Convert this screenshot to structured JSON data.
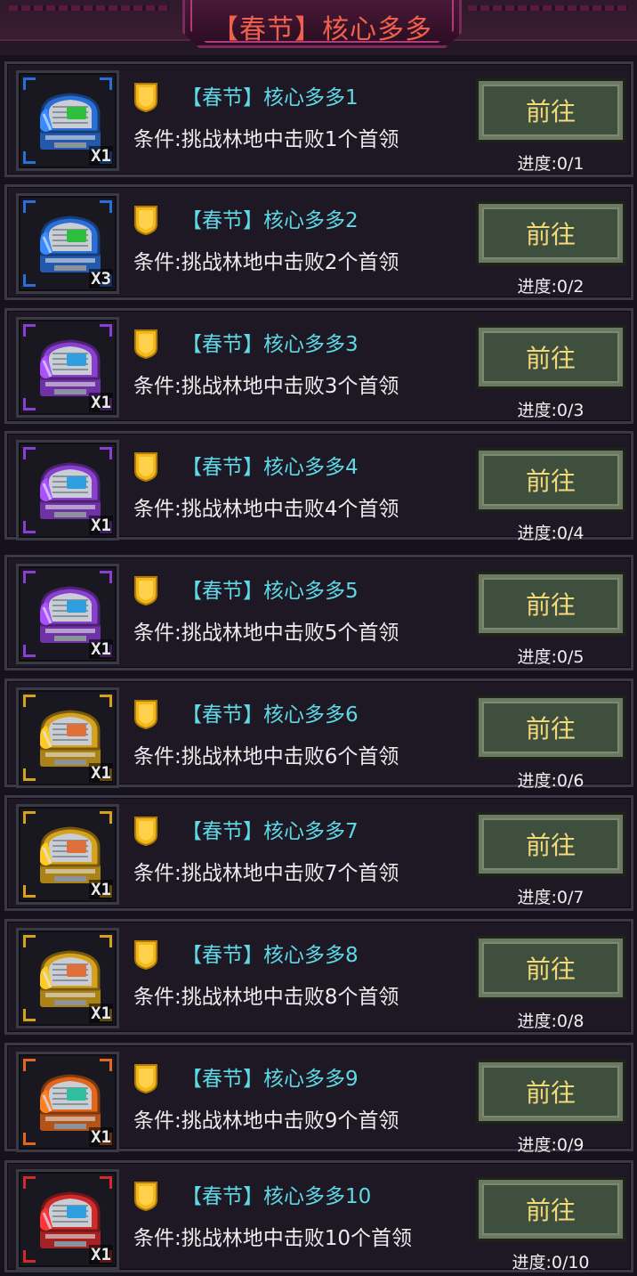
{
  "header": {
    "title": "【春节】核心多多"
  },
  "tasks": [
    {
      "title": "【春节】核心多多1",
      "condition": "条件:挑战林地中击败1个首领",
      "button": "前往",
      "progress": "进度:0/1",
      "quantity": "X1",
      "chest_icon": "blue-chest-icon",
      "color": "#2a6fd8"
    },
    {
      "title": "【春节】核心多多2",
      "condition": "条件:挑战林地中击败2个首领",
      "button": "前往",
      "progress": "进度:0/2",
      "quantity": "X3",
      "chest_icon": "blue-chest-icon",
      "color": "#2a6fd8"
    },
    {
      "title": "【春节】核心多多3",
      "condition": "条件:挑战林地中击败3个首领",
      "button": "前往",
      "progress": "进度:0/3",
      "quantity": "X1",
      "chest_icon": "purple-chest-icon",
      "color": "#8a3fd0"
    },
    {
      "title": "【春节】核心多多4",
      "condition": "条件:挑战林地中击败4个首领",
      "button": "前往",
      "progress": "进度:0/4",
      "quantity": "X1",
      "chest_icon": "purple-chest-icon",
      "color": "#8a3fd0"
    },
    {
      "title": "【春节】核心多多5",
      "condition": "条件:挑战林地中击败5个首领",
      "button": "前往",
      "progress": "进度:0/5",
      "quantity": "X1",
      "chest_icon": "purple-chest-icon",
      "color": "#8a3fd0"
    },
    {
      "title": "【春节】核心多多6",
      "condition": "条件:挑战林地中击败6个首领",
      "button": "前往",
      "progress": "进度:0/6",
      "quantity": "X1",
      "chest_icon": "gold-chest-icon",
      "color": "#d6a21c"
    },
    {
      "title": "【春节】核心多多7",
      "condition": "条件:挑战林地中击败7个首领",
      "button": "前往",
      "progress": "进度:0/7",
      "quantity": "X1",
      "chest_icon": "gold-chest-icon",
      "color": "#d6a21c"
    },
    {
      "title": "【春节】核心多多8",
      "condition": "条件:挑战林地中击败8个首领",
      "button": "前往",
      "progress": "进度:0/8",
      "quantity": "X1",
      "chest_icon": "gold-chest-icon",
      "color": "#d6a21c"
    },
    {
      "title": "【春节】核心多多9",
      "condition": "条件:挑战林地中击败9个首领",
      "button": "前往",
      "progress": "进度:0/9",
      "quantity": "X1",
      "chest_icon": "orange-chest-icon",
      "color": "#e2661c"
    },
    {
      "title": "【春节】核心多多10",
      "condition": "条件:挑战林地中击败10个首领",
      "button": "前往",
      "progress": "进度:0/10",
      "quantity": "X1",
      "chest_icon": "red-chest-icon",
      "color": "#d02a2a"
    }
  ],
  "accent": {
    "title_cyan": "#5ed9e6",
    "button_text": "#f3d97a",
    "header_red": "#f0604a",
    "badge_gold": "#f5b81a"
  }
}
